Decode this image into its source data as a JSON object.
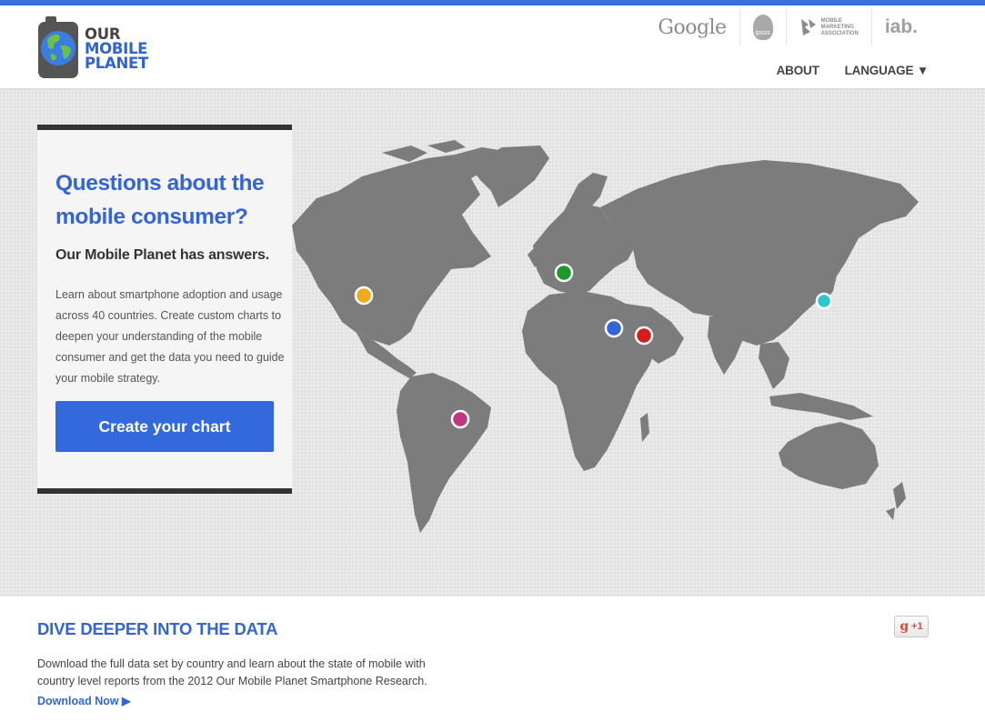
{
  "header": {
    "logo": {
      "line1": "OUR",
      "line2": "MOBILE",
      "line3": "PLANET"
    },
    "partners": {
      "google": "Google",
      "ipsos": "ipsos",
      "mma_line1": "MOBILE",
      "mma_line2": "MARKETING",
      "mma_line3": "ASSOCIATION",
      "iab": "iab."
    },
    "nav": {
      "about": "ABOUT",
      "language": "LANGUAGE ▼"
    }
  },
  "hero": {
    "title": "Questions about the mobile consumer?",
    "subtitle": "Our Mobile Planet has answers.",
    "body": "Learn about smartphone adoption and usage across 40 countries. Create custom charts to deepen your understanding of the mobile consumer and get the data you need to guide your mobile strategy.",
    "cta_label": "Create your chart"
  },
  "map_markers": [
    {
      "region": "north-america",
      "color": "#f0a91c"
    },
    {
      "region": "europe",
      "color": "#1a9a2a"
    },
    {
      "region": "egypt",
      "color": "#3165d8"
    },
    {
      "region": "saudi-arabia",
      "color": "#d81c1c"
    },
    {
      "region": "japan",
      "color": "#2dc7cf"
    },
    {
      "region": "brazil",
      "color": "#c0357d"
    }
  ],
  "bottom": {
    "heading": "DIVE DEEPER INTO THE DATA",
    "body": "Download the full data set by country and learn about the state of mobile with country level reports from the 2012 Our Mobile Planet Smartphone Research.",
    "download_label": "Download Now ▶"
  },
  "share": {
    "g_label": "g",
    "plus_one": "+1"
  },
  "colors": {
    "accent": "#3469dd",
    "map_land": "#7c7c7c",
    "top_bar": "#3a6fe0"
  }
}
